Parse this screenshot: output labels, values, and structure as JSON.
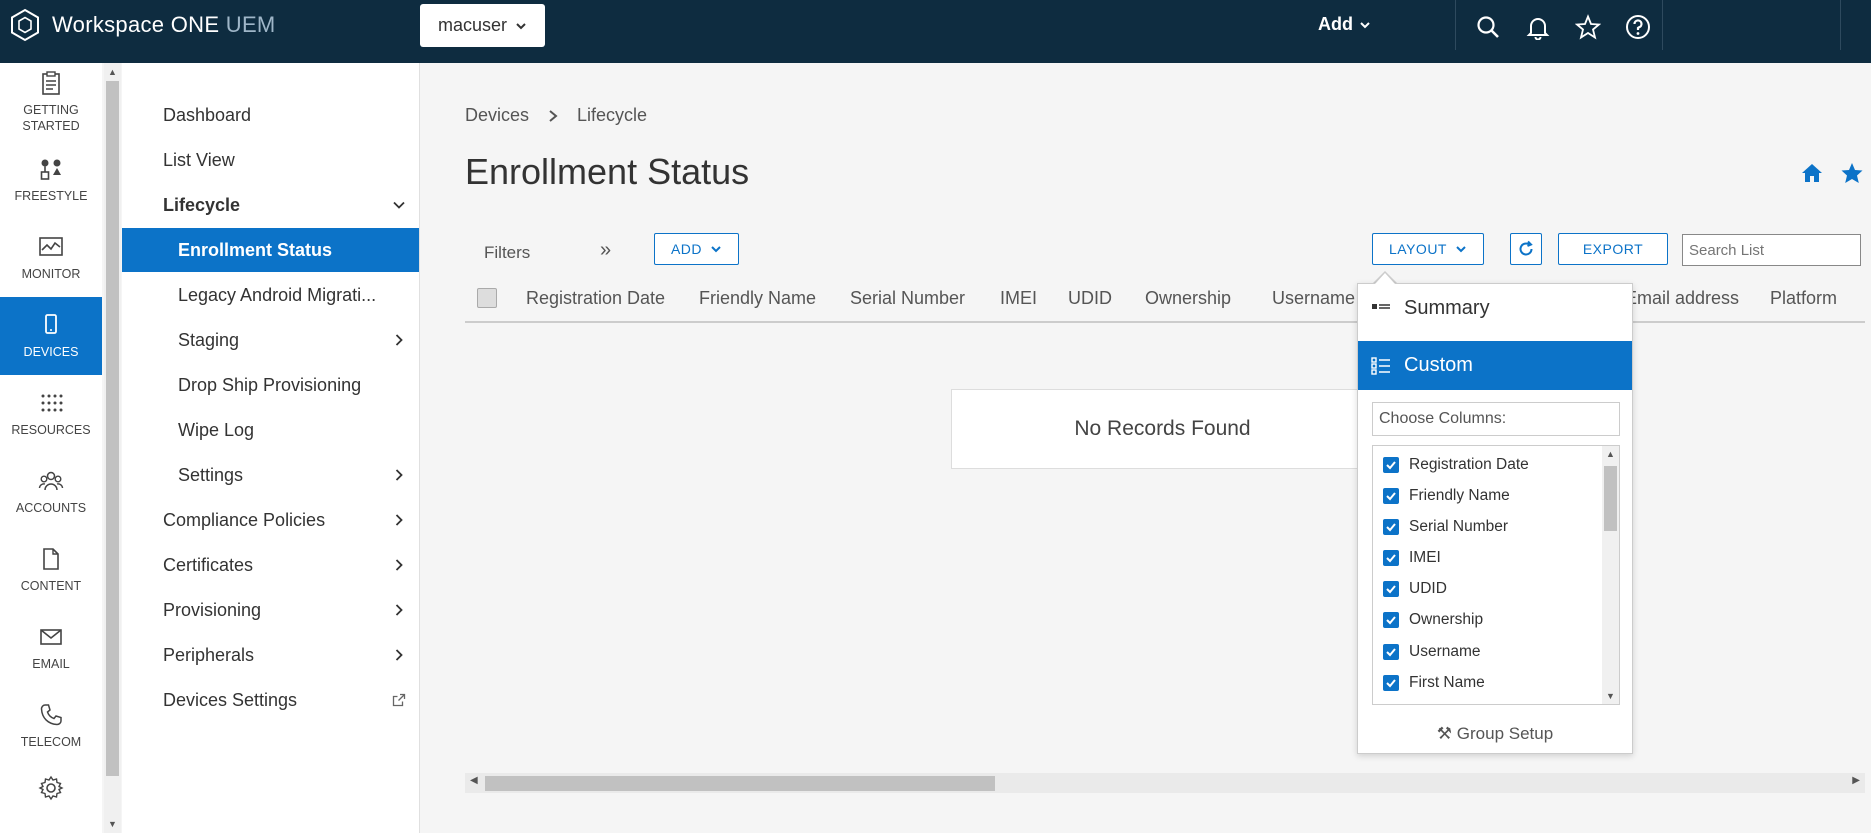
{
  "topbar": {
    "product_name": "Workspace ONE",
    "product_suffix": "UEM",
    "org_group": "macuser",
    "add_label": "Add",
    "icons": [
      "search-icon",
      "bell-icon",
      "star-icon",
      "help-icon"
    ]
  },
  "rail": {
    "items": [
      {
        "label": "GETTING STARTED",
        "icon": "clipboard-icon"
      },
      {
        "label": "FREESTYLE",
        "icon": "freestyle-icon"
      },
      {
        "label": "MONITOR",
        "icon": "monitor-icon"
      },
      {
        "label": "DEVICES",
        "icon": "device-icon",
        "active": true
      },
      {
        "label": "RESOURCES",
        "icon": "grid-icon"
      },
      {
        "label": "ACCOUNTS",
        "icon": "users-icon"
      },
      {
        "label": "CONTENT",
        "icon": "document-icon"
      },
      {
        "label": "EMAIL",
        "icon": "envelope-icon"
      },
      {
        "label": "TELECOM",
        "icon": "phone-icon"
      },
      {
        "label": "",
        "icon": "gear-icon"
      }
    ]
  },
  "subnav": {
    "items": [
      {
        "label": "Dashboard"
      },
      {
        "label": "List View"
      },
      {
        "label": "Lifecycle"
      },
      {
        "label": "Enrollment Status"
      },
      {
        "label": "Legacy Android Migrati..."
      },
      {
        "label": "Staging"
      },
      {
        "label": "Drop Ship Provisioning"
      },
      {
        "label": "Wipe Log"
      },
      {
        "label": "Settings"
      },
      {
        "label": "Compliance Policies"
      },
      {
        "label": "Certificates"
      },
      {
        "label": "Provisioning"
      },
      {
        "label": "Peripherals"
      },
      {
        "label": "Devices Settings"
      }
    ]
  },
  "main": {
    "breadcrumb": [
      "Devices",
      "Lifecycle"
    ],
    "title": "Enrollment Status",
    "filters_label": "Filters",
    "add_button": "ADD",
    "layout_button": "LAYOUT",
    "export_button": "EXPORT",
    "search_placeholder": "Search List",
    "columns": [
      "Registration Date",
      "Friendly Name",
      "Serial Number",
      "IMEI",
      "UDID",
      "Ownership",
      "Username",
      "Email address",
      "Platform"
    ],
    "empty_message": "No Records Found"
  },
  "layout_menu": {
    "options": [
      {
        "label": "Summary",
        "selected": false
      },
      {
        "label": "Custom",
        "selected": true
      }
    ],
    "choose_columns_label": "Choose Columns:",
    "column_choices": [
      "Registration Date",
      "Friendly Name",
      "Serial Number",
      "IMEI",
      "UDID",
      "Ownership",
      "Username",
      "First Name"
    ],
    "group_setup_label": "Group Setup"
  },
  "colors": {
    "topbar": "#0e2c40",
    "accent": "#0c73c8"
  }
}
